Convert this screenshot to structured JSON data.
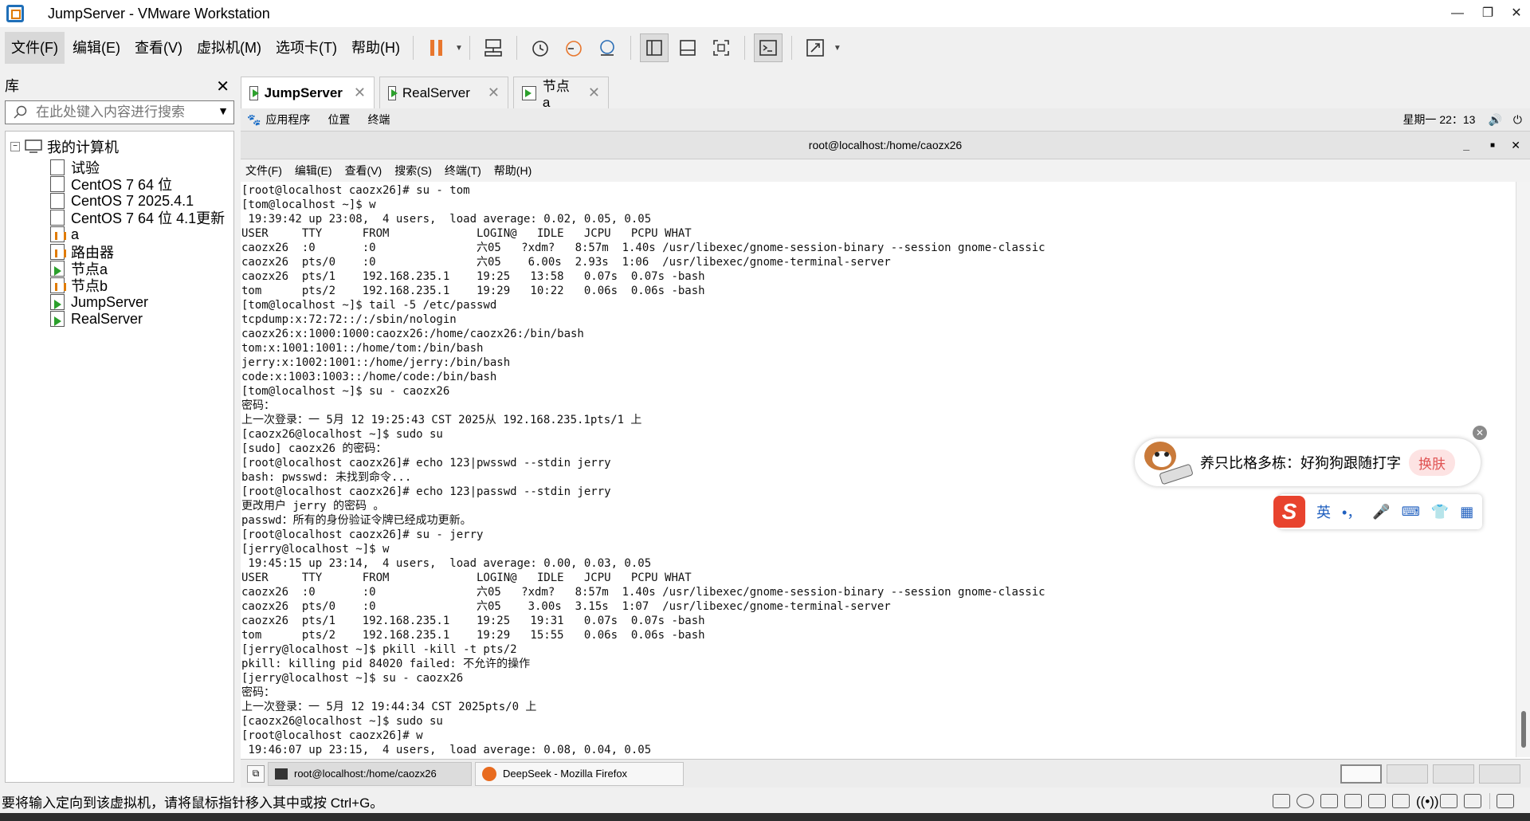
{
  "window": {
    "title": "JumpServer - VMware Workstation",
    "minimize": "—",
    "restore": "❐",
    "close": "✕"
  },
  "menu": {
    "file": "文件(F)",
    "edit": "编辑(E)",
    "view": "查看(V)",
    "vm": "虚拟机(M)",
    "tabs": "选项卡(T)",
    "help": "帮助(H)"
  },
  "library": {
    "title": "库",
    "close": "✕",
    "search_placeholder": "在此处键入内容进行搜索",
    "root_label": "我的计算机",
    "items": [
      {
        "label": "试验",
        "state": "off"
      },
      {
        "label": "CentOS 7 64 位",
        "state": "off"
      },
      {
        "label": "CentOS 7 2025.4.1",
        "state": "off"
      },
      {
        "label": "CentOS 7 64 位 4.1更新",
        "state": "off"
      },
      {
        "label": "a",
        "state": "paused"
      },
      {
        "label": "路由器",
        "state": "paused"
      },
      {
        "label": "节点a",
        "state": "running"
      },
      {
        "label": "节点b",
        "state": "paused"
      },
      {
        "label": "JumpServer",
        "state": "running"
      },
      {
        "label": "RealServer",
        "state": "running"
      }
    ]
  },
  "tabs": [
    {
      "label": "JumpServer",
      "active": true
    },
    {
      "label": "RealServer",
      "active": false
    },
    {
      "label": "节点a",
      "active": false
    }
  ],
  "gnome": {
    "apps": "应用程序",
    "places": "位置",
    "terminal": "终端",
    "clock": "星期一 22：13"
  },
  "terminal": {
    "title": "root@localhost:/home/caozx26",
    "menu": {
      "file": "文件(F)",
      "edit": "编辑(E)",
      "view": "查看(V)",
      "search": "搜索(S)",
      "terminal": "终端(T)",
      "help": "帮助(H)"
    },
    "lines": [
      "[root@localhost caozx26]# su - tom",
      "[tom@localhost ~]$ w",
      " 19:39:42 up 23:08,  4 users,  load average: 0.02, 0.05, 0.05",
      "USER     TTY      FROM             LOGIN@   IDLE   JCPU   PCPU WHAT",
      "caozx26  :0       :0               六05   ?xdm?   8:57m  1.40s /usr/libexec/gnome-session-binary --session gnome-classic",
      "caozx26  pts/0    :0               六05    6.00s  2.93s  1:06  /usr/libexec/gnome-terminal-server",
      "caozx26  pts/1    192.168.235.1    19:25   13:58   0.07s  0.07s -bash",
      "tom      pts/2    192.168.235.1    19:29   10:22   0.06s  0.06s -bash",
      "[tom@localhost ~]$ tail -5 /etc/passwd",
      "tcpdump:x:72:72::/:/sbin/nologin",
      "caozx26:x:1000:1000:caozx26:/home/caozx26:/bin/bash",
      "tom:x:1001:1001::/home/tom:/bin/bash",
      "jerry:x:1002:1001::/home/jerry:/bin/bash",
      "code:x:1003:1003::/home/code:/bin/bash",
      "[tom@localhost ~]$ su - caozx26",
      "密码：",
      "上一次登录：一 5月 12 19:25:43 CST 2025从 192.168.235.1pts/1 上",
      "[caozx26@localhost ~]$ sudo su",
      "[sudo] caozx26 的密码：",
      "[root@localhost caozx26]# echo 123|pwsswd --stdin jerry",
      "bash: pwsswd: 未找到命令...",
      "[root@localhost caozx26]# echo 123|passwd --stdin jerry",
      "更改用户 jerry 的密码 。",
      "passwd：所有的身份验证令牌已经成功更新。",
      "[root@localhost caozx26]# su - jerry",
      "[jerry@localhost ~]$ w",
      " 19:45:15 up 23:14,  4 users,  load average: 0.00, 0.03, 0.05",
      "USER     TTY      FROM             LOGIN@   IDLE   JCPU   PCPU WHAT",
      "caozx26  :0       :0               六05   ?xdm?   8:57m  1.40s /usr/libexec/gnome-session-binary --session gnome-classic",
      "caozx26  pts/0    :0               六05    3.00s  3.15s  1:07  /usr/libexec/gnome-terminal-server",
      "caozx26  pts/1    192.168.235.1    19:25   19:31   0.07s  0.07s -bash",
      "tom      pts/2    192.168.235.1    19:29   15:55   0.06s  0.06s -bash",
      "[jerry@localhost ~]$ pkill -kill -t pts/2",
      "pkill: killing pid 84020 failed: 不允许的操作",
      "[jerry@localhost ~]$ su - caozx26",
      "密码：",
      "上一次登录：一 5月 12 19:44:34 CST 2025pts/0 上",
      "[caozx26@localhost ~]$ sudo su",
      "[root@localhost caozx26]# w",
      " 19:46:07 up 23:15,  4 users,  load average: 0.08, 0.04, 0.05"
    ]
  },
  "taskbar": {
    "task1": "root@localhost:/home/caozx26",
    "task2": "DeepSeek - Mozilla Firefox"
  },
  "overlay": {
    "pet_text": "养只比格多栋：好狗狗跟随打字",
    "pet_skin": "换肤",
    "ime_logo": "S",
    "ime_lang": "英",
    "ime_punct": "•，"
  },
  "status": {
    "message": "要将输入定向到该虚拟机，请将鼠标指针移入其中或按 Ctrl+G。"
  }
}
